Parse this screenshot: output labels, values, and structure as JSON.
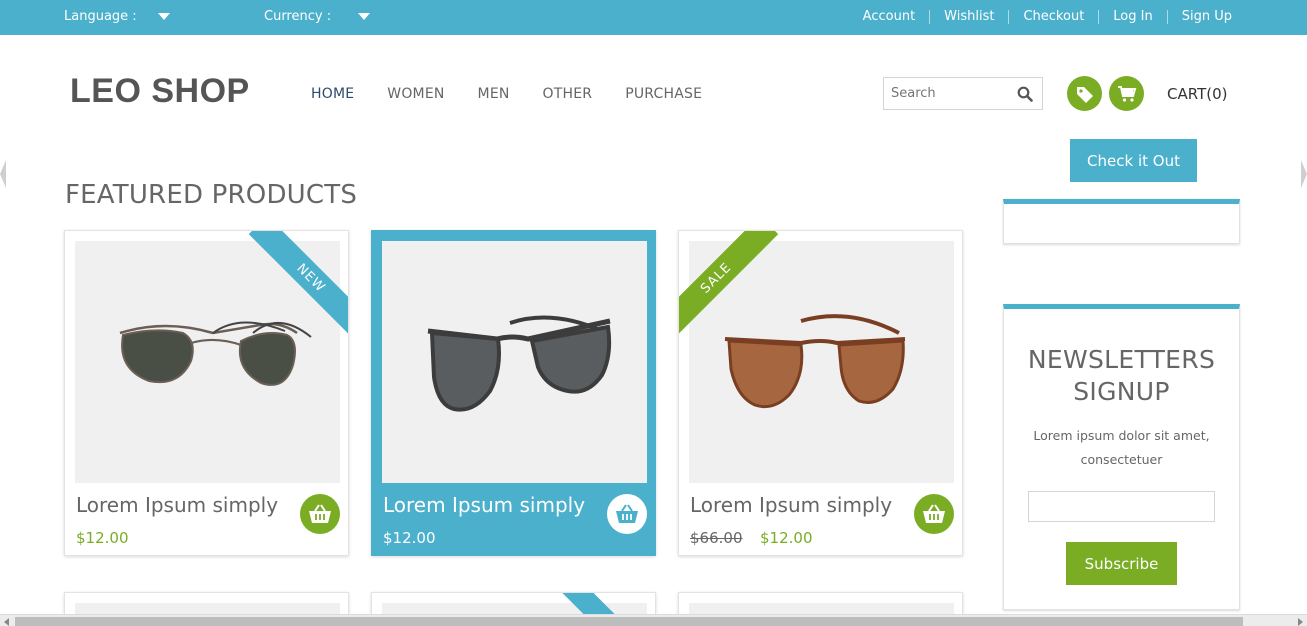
{
  "colors": {
    "accent": "#4bb0cc",
    "green": "#7aad24"
  },
  "topbar": {
    "language_label": "Language :",
    "currency_label": "Currency :",
    "links": [
      "Account",
      "Wishlist",
      "Checkout",
      "Log In",
      "Sign Up"
    ]
  },
  "header": {
    "logo": "LEO SHOP",
    "nav": [
      "HOME",
      "WOMEN",
      "MEN",
      "OTHER",
      "PURCHASE"
    ],
    "active_nav": "HOME",
    "search_placeholder": "Search",
    "cart_label": "CART(0)"
  },
  "sidebar": {
    "check_button": "Check it Out",
    "newsletter": {
      "title_line1": "NEWSLETTERS",
      "title_line2": "SIGNUP",
      "text": "Lorem ipsum dolor sit amet, consectetuer",
      "email_value": "",
      "button": "Subscribe"
    }
  },
  "main": {
    "section_title": "FEATURED PRODUCTS",
    "products": [
      {
        "name": "Lorem Ipsum simply",
        "price": "$12.00",
        "ribbon": "NEW",
        "icon": "aviator-sunglasses"
      },
      {
        "name": "Lorem Ipsum simply",
        "price": "$12.00",
        "ribbon": "",
        "icon": "wayfarer-sunglasses"
      },
      {
        "name": "Lorem Ipsum simply",
        "old_price": "$66.00",
        "price": "$12.00",
        "ribbon": "SALE",
        "icon": "brown-sunglasses"
      }
    ]
  }
}
